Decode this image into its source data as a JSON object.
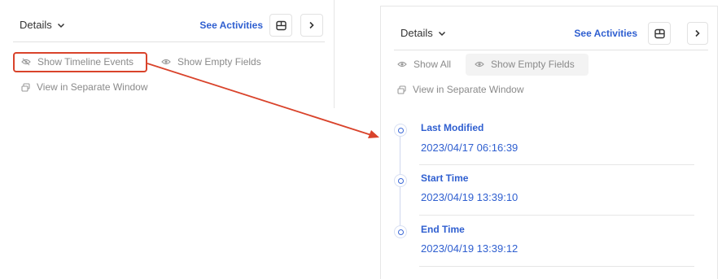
{
  "left_panel": {
    "title": "Details",
    "see_activities": "See Activities",
    "options": {
      "show_timeline_events": "Show Timeline Events",
      "show_empty_fields": "Show Empty Fields",
      "view_separate_window": "View in Separate Window"
    }
  },
  "right_panel": {
    "title": "Details",
    "see_activities": "See Activities",
    "options": {
      "show_all": "Show All",
      "show_empty_fields": "Show Empty Fields",
      "view_separate_window": "View in Separate Window"
    },
    "timeline": [
      {
        "label": "Last Modified",
        "value": "2023/04/17 06:16:39"
      },
      {
        "label": "Start Time",
        "value": "2023/04/19 13:39:10"
      },
      {
        "label": "End Time",
        "value": "2023/04/19 13:39:12"
      }
    ]
  },
  "colors": {
    "accent": "#2f5fd0",
    "highlight": "#d9432b",
    "muted_text": "#8a8a8a"
  }
}
